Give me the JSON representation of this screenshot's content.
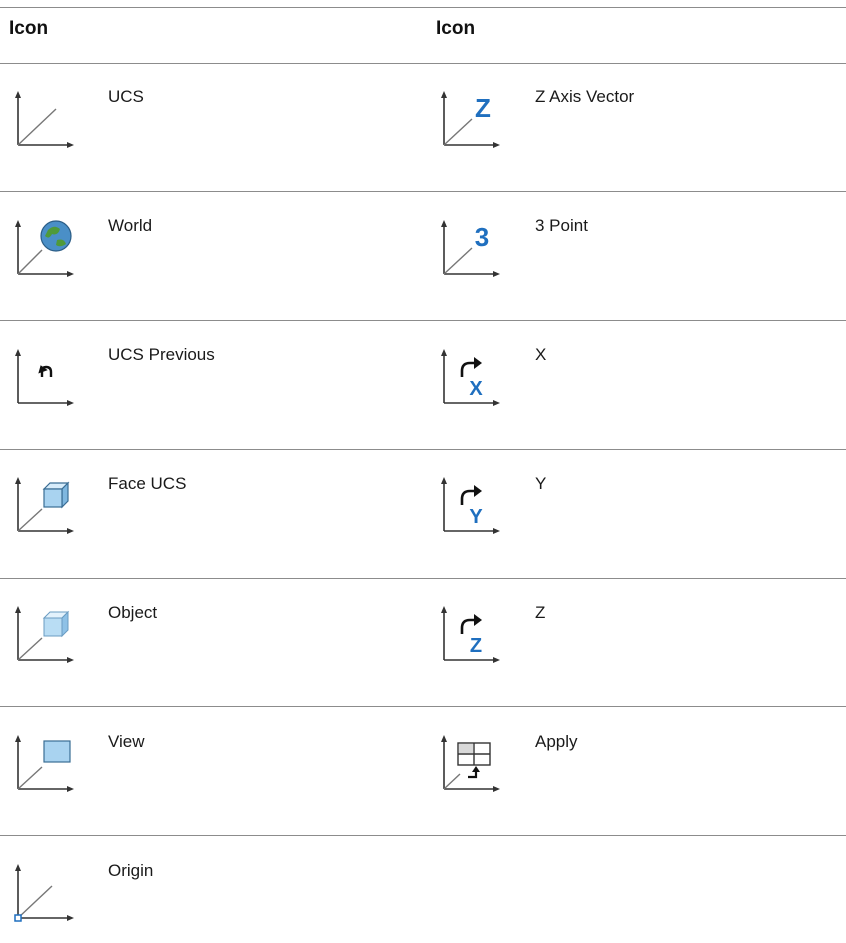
{
  "table": {
    "headers": [
      "Icon",
      "Icon"
    ],
    "left_column": [
      {
        "label": "UCS",
        "icon": "ucs-icon"
      },
      {
        "label": "World",
        "icon": "ucs-world-icon"
      },
      {
        "label": "UCS Previous",
        "icon": "ucs-previous-icon"
      },
      {
        "label": "Face UCS",
        "icon": "face-ucs-icon"
      },
      {
        "label": "Object",
        "icon": "ucs-object-icon"
      },
      {
        "label": "View",
        "icon": "ucs-view-icon"
      },
      {
        "label": "Origin",
        "icon": "ucs-origin-icon"
      }
    ],
    "right_column": [
      {
        "label": "Z Axis Vector",
        "icon": "z-axis-vector-icon",
        "glyph": "Z"
      },
      {
        "label": "3 Point",
        "icon": "three-point-icon",
        "glyph": "3"
      },
      {
        "label": "X",
        "icon": "rotate-x-icon",
        "glyph": "X"
      },
      {
        "label": "Y",
        "icon": "rotate-y-icon",
        "glyph": "Y"
      },
      {
        "label": "Z",
        "icon": "rotate-z-icon",
        "glyph": "Z"
      },
      {
        "label": "Apply",
        "icon": "ucs-apply-icon"
      }
    ]
  },
  "colors": {
    "rule": "#8c8c8c",
    "axis": "#333333",
    "accent_blue": "#1f6fbf",
    "box_fill": "#a9d3f0",
    "box_stroke": "#3a6d94"
  }
}
